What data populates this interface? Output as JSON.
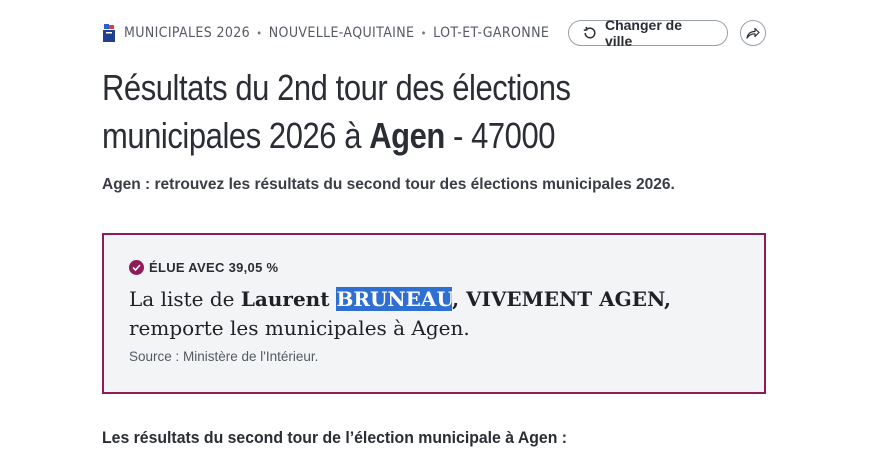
{
  "breadcrumb": {
    "items": [
      "MUNICIPALES 2026",
      "NOUVELLE-AQUITAINE",
      "LOT-ET-GARONNE"
    ],
    "separator": "•"
  },
  "actions": {
    "change_city_label": "Changer de ville"
  },
  "title": {
    "line1": "Résultats du 2nd tour des élections",
    "line2_prefix": "municipales 2026 à ",
    "city": "Agen",
    "line2_suffix": " - 47000"
  },
  "subtitle": "Agen : retrouvez les résultats du second tour des élections municipales 2026.",
  "result": {
    "elected_label": "ÉLUE AVEC 39,05 %",
    "prefix": "La liste de ",
    "first_name": "Laurent ",
    "last_name": "BRUNEAU",
    "list_name": ", VIVEMENT AGEN,",
    "suffix": "remporte les municipales à Agen.",
    "source": "Source : Ministère de l'Intérieur."
  },
  "section": {
    "title": "Les résultats du second tour de l’élection municipale à Agen :"
  },
  "colors": {
    "accent": "#8f1b5b",
    "highlight": "#2f6fd1",
    "box_bg": "#f3f4f6"
  }
}
